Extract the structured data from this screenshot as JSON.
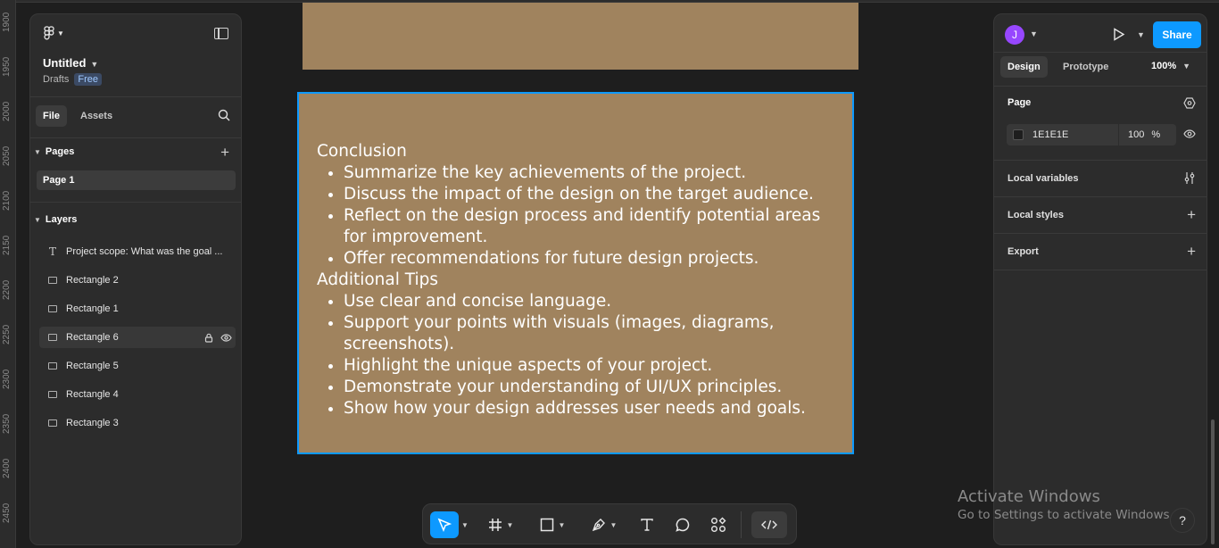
{
  "ruler": {
    "labels": [
      "1900",
      "1950",
      "2000",
      "2050",
      "2100",
      "2150",
      "2200",
      "2250",
      "2300",
      "2350",
      "2400",
      "2450"
    ]
  },
  "file": {
    "title": "Untitled",
    "location": "Drafts",
    "plan": "Free"
  },
  "left_tabs": {
    "file": "File",
    "assets": "Assets"
  },
  "pages": {
    "heading": "Pages",
    "items": [
      {
        "label": "Page 1"
      }
    ]
  },
  "layers": {
    "heading": "Layers",
    "items": [
      {
        "label": "Project scope: What was the goal ...",
        "type": "text"
      },
      {
        "label": "Rectangle 2",
        "type": "rect"
      },
      {
        "label": "Rectangle 1",
        "type": "rect"
      },
      {
        "label": "Rectangle 6",
        "type": "rect"
      },
      {
        "label": "Rectangle 5",
        "type": "rect"
      },
      {
        "label": "Rectangle 4",
        "type": "rect"
      },
      {
        "label": "Rectangle 3",
        "type": "rect"
      }
    ]
  },
  "canvas": {
    "frame_color": "#a0835e",
    "selection_color": "#0d99ff",
    "heading1": "Conclusion",
    "list1": [
      "Summarize the key achievements of the project.",
      "Discuss the impact of the design on the target audience.",
      "Reflect on the design process and identify potential areas for improvement.",
      "Offer recommendations for future design projects."
    ],
    "heading2": "Additional Tips",
    "list2": [
      "Use clear and concise language.",
      "Support your points with visuals (images, diagrams, screenshots).",
      "Highlight the unique aspects of your project.",
      "Demonstrate your understanding of UI/UX principles.",
      "Show how your design addresses user needs and goals."
    ]
  },
  "right_panel": {
    "avatar_initial": "J",
    "share": "Share",
    "tabs": {
      "design": "Design",
      "prototype": "Prototype"
    },
    "zoom": "100%",
    "page_heading": "Page",
    "background_hex": "1E1E1E",
    "background_opacity": "100",
    "percent": "%",
    "local_variables": "Local variables",
    "local_styles": "Local styles",
    "export": "Export"
  },
  "toolbar": {
    "tools": [
      "move-tool",
      "frame-tool",
      "shape-tool",
      "pen-tool",
      "text-tool",
      "comment-tool",
      "actions-tool",
      "dev-mode"
    ]
  },
  "watermark": {
    "line1": "Activate Windows",
    "line2": "Go to Settings to activate Windows."
  },
  "help": "?"
}
